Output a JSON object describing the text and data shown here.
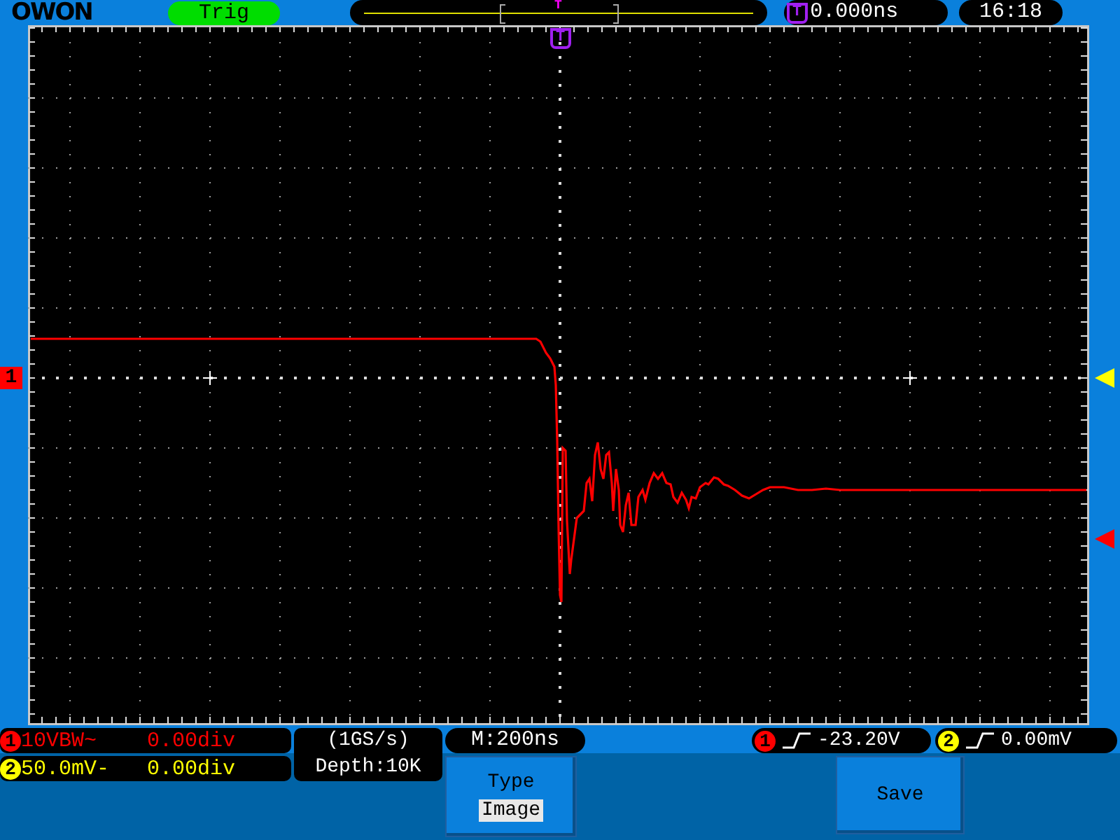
{
  "top_bar": {
    "logo": "OWON",
    "status": "Trig",
    "position_marker": "T",
    "trigger_time": {
      "marker": "T",
      "value": "0.000ns"
    },
    "clock": "16:18"
  },
  "screen": {
    "trigger_marker": "T",
    "channel_marker": "1"
  },
  "channels": [
    {
      "number": "1",
      "color": "#ff0000",
      "scale": "10VBW~",
      "offset": "0.00div"
    },
    {
      "number": "2",
      "color": "#ffff00",
      "scale": "50.0mV-",
      "offset": "0.00div"
    }
  ],
  "acquisition": {
    "sample_rate": "(1GS/s)",
    "depth": "Depth:10K"
  },
  "timebase": "M:200ns",
  "trigger": [
    {
      "channel": "1",
      "color": "#ff0000",
      "value": "-23.20V"
    },
    {
      "channel": "2",
      "color": "#ffff00",
      "value": "0.00mV"
    }
  ],
  "menu": [
    {
      "kind": "option",
      "title": "Type",
      "value": "Image"
    },
    {
      "kind": "action",
      "title": "Save"
    }
  ]
}
